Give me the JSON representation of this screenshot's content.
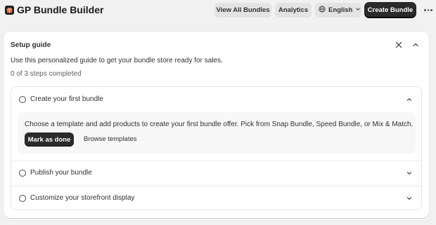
{
  "header": {
    "title": "GP Bundle Builder",
    "logo_icon": "gift-box-icon",
    "buttons": {
      "view_all_bundles": "View All Bundles",
      "analytics": "Analytics",
      "language": "English",
      "create_bundle": "Create Bundle"
    }
  },
  "setup_guide": {
    "title": "Setup guide",
    "description": "Use this personalized guide to get your bundle store ready for sales.",
    "progress": "0 of 3 steps completed",
    "steps": [
      {
        "label": "Create your first bundle",
        "expanded": true,
        "completed": false,
        "details": "Choose a template and add products to create your first bundle offer. Pick from Snap Bundle, Speed Bundle, or Mix & Match.",
        "primary_action": "Mark as done",
        "secondary_action": "Browse templates"
      },
      {
        "label": "Publish your bundle",
        "expanded": false,
        "completed": false
      },
      {
        "label": "Customize your storefront display",
        "expanded": false,
        "completed": false
      }
    ]
  },
  "colors": {
    "background": "#f1f1f1",
    "card": "#ffffff",
    "primary_button": "#2b2b2b",
    "secondary_button": "#e3e3e3",
    "panel": "#f7f7f7"
  }
}
